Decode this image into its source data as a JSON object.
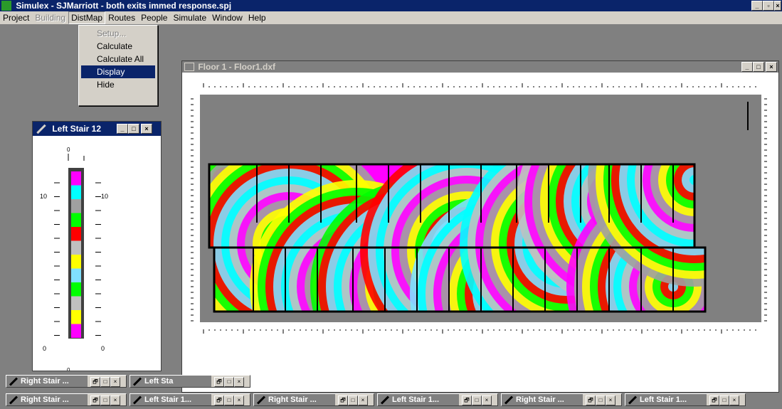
{
  "app": {
    "title": "Simulex - SJMarriott - both exits immed response.spj"
  },
  "menubar": {
    "items": [
      {
        "label": "Project",
        "state": "normal"
      },
      {
        "label": "Building",
        "state": "disabled"
      },
      {
        "label": "DistMap",
        "state": "active"
      },
      {
        "label": "Routes",
        "state": "normal"
      },
      {
        "label": "People",
        "state": "normal"
      },
      {
        "label": "Simulate",
        "state": "normal"
      },
      {
        "label": "Window",
        "state": "normal"
      },
      {
        "label": "Help",
        "state": "normal"
      }
    ]
  },
  "distmap_menu": {
    "items": [
      {
        "label": "Setup...",
        "state": "disabled"
      },
      {
        "label": "Calculate",
        "state": "normal"
      },
      {
        "label": "Calculate All",
        "state": "normal"
      },
      {
        "label": "Display",
        "state": "highlighted"
      },
      {
        "label": "Hide",
        "state": "normal"
      }
    ]
  },
  "floor_window": {
    "title": "Floor 1 - Floor1.dxf"
  },
  "stair_window": {
    "title": "Left Stair 12",
    "scale_top": "0",
    "scale_bottom": "0",
    "label_10_left": "10",
    "label_10_right": "10",
    "label_0_left": "0",
    "label_0_right": "0"
  },
  "taskbar_row1": [
    {
      "label": "Right Stair ..."
    },
    {
      "label": "Left Sta"
    }
  ],
  "taskbar_row2": [
    {
      "label": "Right Stair ..."
    },
    {
      "label": "Left Stair 1..."
    },
    {
      "label": "Right Stair ..."
    },
    {
      "label": "Left Stair 1..."
    },
    {
      "label": "Right Stair ..."
    },
    {
      "label": "Left Stair 1..."
    }
  ],
  "colors": {
    "titlebar_active": "#0a246a",
    "window_face": "#d4d0c8",
    "plot_bg": "#808080",
    "band_colors": [
      "#ff00ff",
      "#a0a0a0",
      "#ffff00",
      "#00ff00",
      "#ff0000",
      "#80e0ff",
      "#00ffff",
      "#c0c0c0"
    ]
  }
}
